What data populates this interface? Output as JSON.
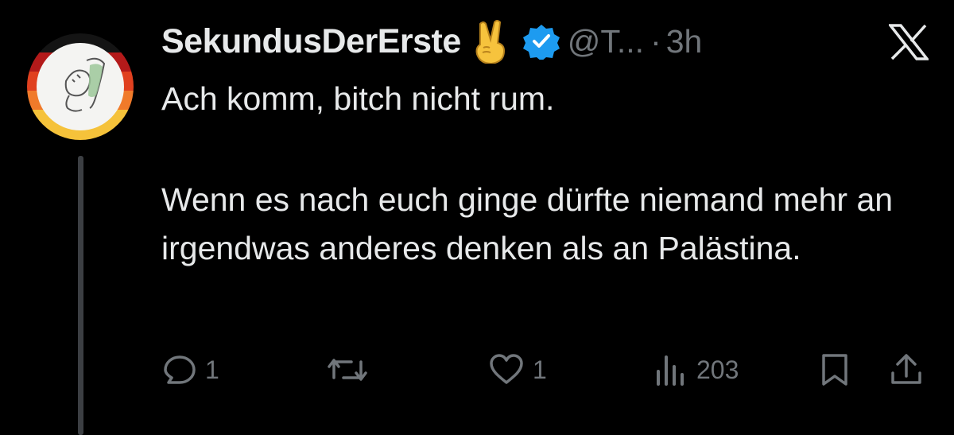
{
  "tweet": {
    "display_name": "SekundusDerErste",
    "emoji_icon": "victory-hand-emoji",
    "verified_icon": "verified-badge-icon",
    "handle": "@T...",
    "separator": "·",
    "time": "3h",
    "body": [
      "Ach komm, bitch nicht rum.",
      "Wenn es nach euch ginge dürfte niemand mehr an irgendwas anderes denken als an Palästina."
    ]
  },
  "actions": {
    "reply_count": "1",
    "repost_count": "",
    "like_count": "1",
    "views_count": "203"
  },
  "colors": {
    "background": "#000000",
    "text_primary": "#e7e9ea",
    "text_secondary": "#71767b",
    "verified_blue": "#1d9bf0"
  }
}
